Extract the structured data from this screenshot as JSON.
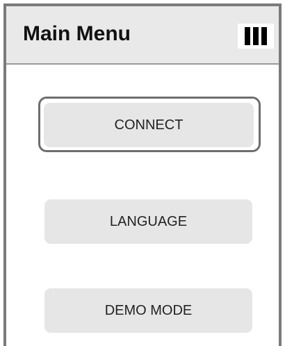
{
  "header": {
    "title": "Main Menu",
    "status_icon": "signal-bars-icon"
  },
  "menu": {
    "items": [
      {
        "label": "CONNECT",
        "focused": true
      },
      {
        "label": "LANGUAGE",
        "focused": false
      },
      {
        "label": "DEMO MODE",
        "focused": false
      }
    ]
  },
  "colors": {
    "header_bg": "#e9e9e9",
    "button_bg": "#e6e6e6",
    "frame_border": "#7a7a7a",
    "focus_ring": "#6e6e6e"
  }
}
